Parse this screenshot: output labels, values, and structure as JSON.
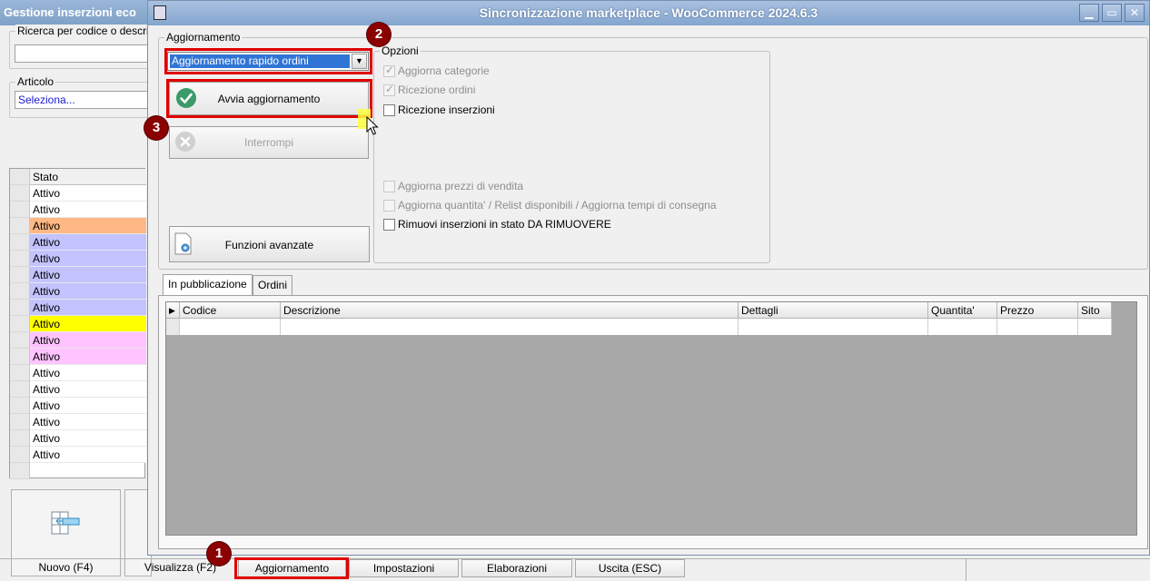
{
  "background_window": {
    "title": "Gestione inserzioni eco",
    "search_label": "Ricerca per codice o descri",
    "search_value": "",
    "article_label": "Articolo",
    "article_value": "Seleziona...",
    "grid_header": "Stato",
    "rows": [
      {
        "label": "Attivo",
        "color": "#ffffff"
      },
      {
        "label": "Attivo",
        "color": "#ffffff"
      },
      {
        "label": "Attivo",
        "color": "#ffb883"
      },
      {
        "label": "Attivo",
        "color": "#c3c3ff"
      },
      {
        "label": "Attivo",
        "color": "#c3c3ff"
      },
      {
        "label": "Attivo",
        "color": "#c3c3ff"
      },
      {
        "label": "Attivo",
        "color": "#c3c3ff"
      },
      {
        "label": "Attivo",
        "color": "#c3c3ff"
      },
      {
        "label": "Attivo",
        "color": "#ffff00"
      },
      {
        "label": "Attivo",
        "color": "#ffc3ff"
      },
      {
        "label": "Attivo",
        "color": "#ffc3ff"
      },
      {
        "label": "Attivo",
        "color": "#ffffff"
      },
      {
        "label": "Attivo",
        "color": "#ffffff"
      },
      {
        "label": "Attivo",
        "color": "#ffffff"
      },
      {
        "label": "Attivo",
        "color": "#ffffff"
      },
      {
        "label": "Attivo",
        "color": "#ffffff"
      },
      {
        "label": "Attivo",
        "color": "#ffffff"
      }
    ],
    "new_button": "Nuovo (F4)"
  },
  "dialog": {
    "title": "Sincronizzazione marketplace - WooCommerce 2024.6.3",
    "update_group_label": "Aggiornamento",
    "update_mode_value": "Aggiornamento rapido ordini",
    "start_button": "Avvia aggiornamento",
    "stop_button": "Interrompi",
    "advanced_button": "Funzioni avanzate",
    "options_label": "Opzioni",
    "options": [
      {
        "label": "Aggiorna categorie",
        "checked": true,
        "enabled": false
      },
      {
        "label": "Ricezione ordini",
        "checked": true,
        "enabled": false
      },
      {
        "label": "Ricezione inserzioni",
        "checked": false,
        "enabled": true
      },
      {
        "label": "Aggiorna prezzi di vendita",
        "checked": false,
        "enabled": false
      },
      {
        "label": "Aggiorna quantita' / Relist disponibili / Aggiorna tempi di consegna",
        "checked": false,
        "enabled": false
      },
      {
        "label": "Rimuovi inserzioni in stato DA RIMUOVERE",
        "checked": false,
        "enabled": true
      }
    ],
    "tabs": [
      "In pubblicazione",
      "Ordini"
    ],
    "grid_columns": [
      "Codice",
      "Descrizione",
      "Dettagli",
      "Quantita'",
      "Prezzo",
      "Sito"
    ]
  },
  "bottom_buttons": [
    "Visualizza (F2)",
    "Aggiornamento",
    "Impostazioni",
    "Elaborazioni",
    "Uscita (ESC)"
  ],
  "badges": [
    "1",
    "2",
    "3"
  ],
  "window_controls": {
    "minimize": "▁",
    "maximize": "▭",
    "close": "✕"
  },
  "icons": {
    "dialog_system": "window-icon",
    "start": "check-circle-icon",
    "stop": "x-circle-icon",
    "advanced": "gear-document-icon",
    "new": "table-insert-icon"
  }
}
